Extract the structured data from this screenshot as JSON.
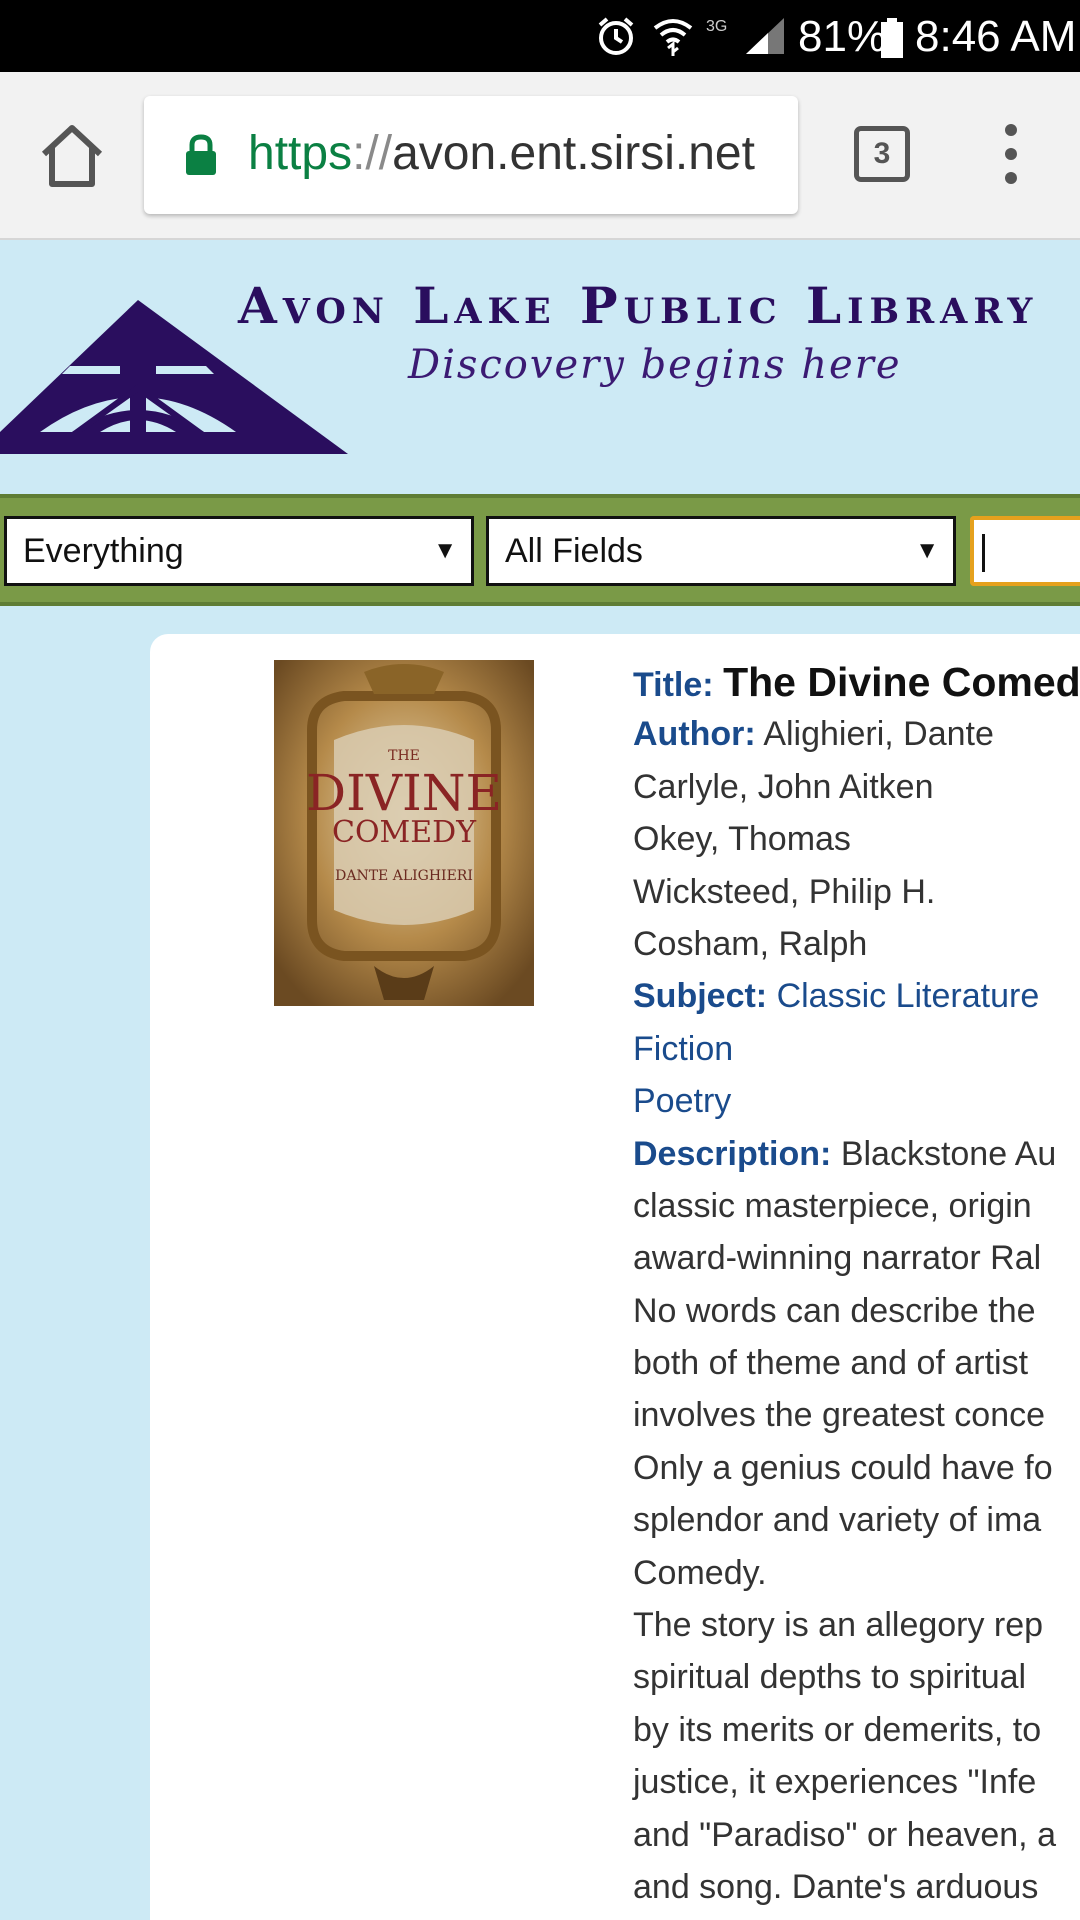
{
  "status_bar": {
    "battery": "81%",
    "time": "8:46 AM",
    "network": "3G",
    "icons": [
      "alarm-icon",
      "wifi-icon",
      "signal-icon",
      "battery-icon"
    ]
  },
  "browser": {
    "url_scheme": "https",
    "url_sep": "://",
    "url_host": "avon.ent.sirsi.net",
    "tab_count": "3",
    "icons": [
      "home-icon",
      "lock-icon",
      "tabs-icon",
      "overflow-menu-icon"
    ]
  },
  "header": {
    "library_name": "Avon Lake Public Library",
    "tagline": "Discovery begins here",
    "colors": {
      "brand": "#2a0e5e",
      "header_bg": "#cdeaf5",
      "search_bg": "#7a9a47"
    }
  },
  "search": {
    "library_select": "Everything",
    "field_select": "All Fields",
    "query": ""
  },
  "record": {
    "title_label": "Title:",
    "title": "The Divine Comed",
    "author_label": "Author:",
    "authors": [
      "Alighieri, Dante",
      "Carlyle, John Aitken",
      "Okey, Thomas",
      "Wicksteed, Philip H.",
      "Cosham, Ralph"
    ],
    "subject_label": "Subject:",
    "subjects": [
      "Classic Literature",
      "Fiction",
      "Poetry"
    ],
    "description_label": "Description:",
    "description_lines": [
      "Blackstone Au",
      "classic masterpiece, origin",
      "award-winning narrator Ral",
      "No words can describe the",
      "both of theme and of artist",
      "involves the greatest conce",
      "Only a genius could have fo",
      "splendor and variety of ima",
      "Comedy.",
      "The story is an allegory rep",
      "spiritual depths to spiritual",
      "by its merits or demerits, to",
      "justice, it experiences \"Infe",
      "and \"Paradiso\" or heaven, a",
      "and song. Dante's arduous"
    ],
    "cover": {
      "line1": "THE",
      "line2": "DIVINE",
      "line3": "COMEDY",
      "line4": "DANTE ALIGHIERI"
    }
  }
}
